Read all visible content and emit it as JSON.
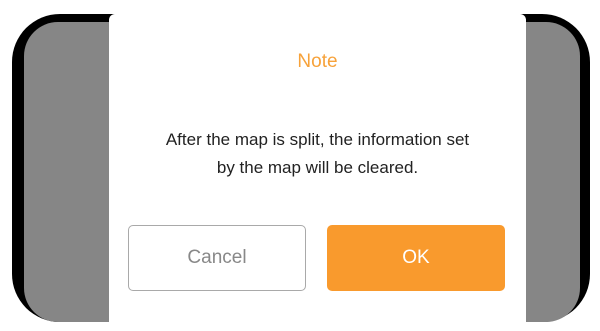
{
  "dialog": {
    "title": "Note",
    "message_line1": "After the map is split, the information set",
    "message_line2": "by the map will be cleared.",
    "cancel_label": "Cancel",
    "ok_label": "OK"
  },
  "colors": {
    "accent": "#f99a2d",
    "title": "#f7a23a",
    "backdrop": "#868686",
    "frame": "#000000"
  }
}
